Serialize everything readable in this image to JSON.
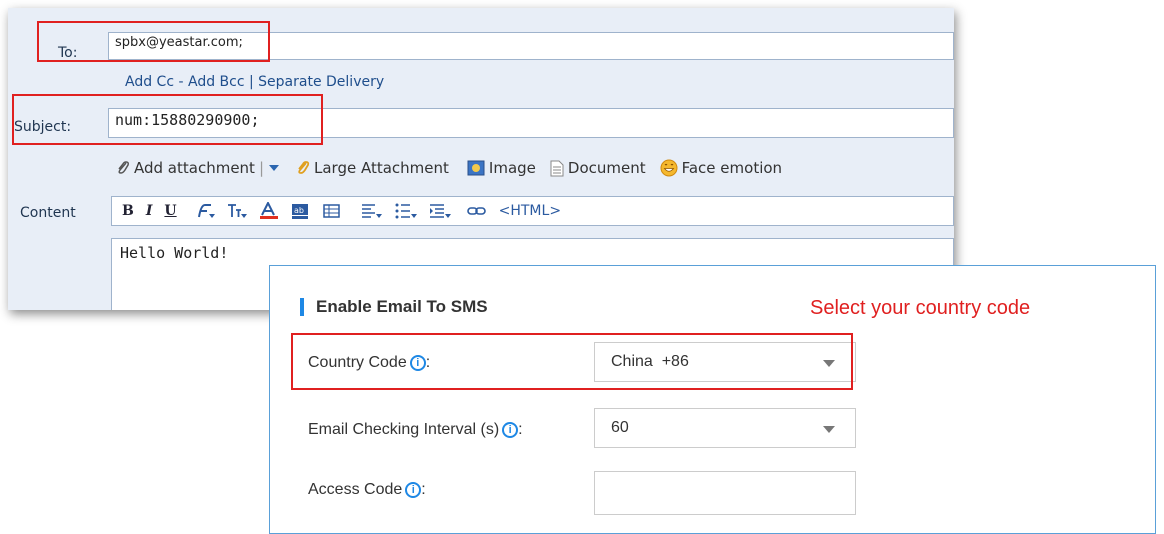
{
  "compose": {
    "to_label": "To:",
    "to_value": "spbx@yeastar.com;",
    "links": {
      "add_cc": "Add Cc",
      "sep1": " - ",
      "add_bcc": "Add Bcc",
      "sep2": " | ",
      "separate_delivery": "Separate Delivery"
    },
    "subject_label": "Subject:",
    "subject_value": "num:15880290900;",
    "toolbar": {
      "add_attachment": "Add attachment",
      "divider": "|",
      "large_attachment": "Large Attachment",
      "image": "Image",
      "document": "Document",
      "face_emotion": "Face emotion"
    },
    "content_label": "Content",
    "editor_buttons": {
      "bold": "B",
      "italic": "I",
      "underline": "U",
      "html": "<HTML>"
    },
    "body_text": "Hello World!"
  },
  "sms": {
    "title": "Enable Email To SMS",
    "hint": "Select your country code",
    "country_code_label": "Country Code",
    "country_code_value": "China  +86",
    "interval_label": "Email Checking Interval (s)",
    "interval_value": "60",
    "access_code_label": "Access Code",
    "access_code_value": "",
    "colon": ":",
    "info_glyph": "i"
  },
  "colors": {
    "annotation_red": "#e02020",
    "accent_blue": "#1e88e5",
    "compose_bg": "#e8eef7"
  }
}
